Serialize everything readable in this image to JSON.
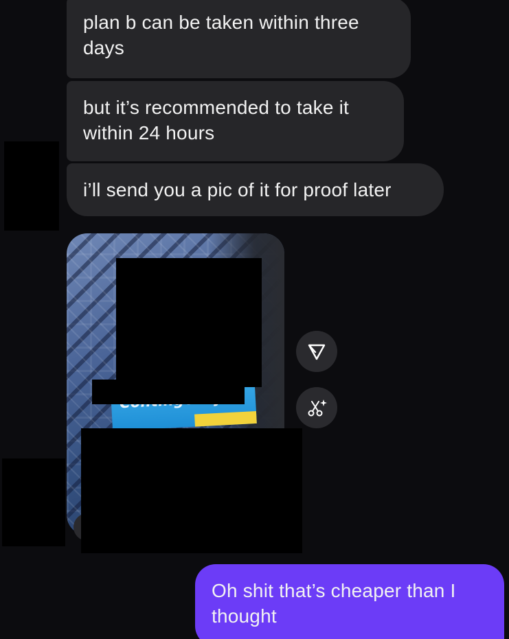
{
  "conversation": {
    "incoming_messages": [
      "plan b can be taken within three days",
      "but it’s recommended to take it within 24 hours",
      "i’ll send you a pic of it for proof later"
    ],
    "photo": {
      "visible_text": "Contingency",
      "action_icons": [
        "share-icon",
        "sparkle-edit-icon"
      ]
    },
    "outgoing_messages": [
      "Oh shit that’s cheaper than I thought"
    ]
  },
  "colors": {
    "background": "#0c0c0f",
    "incoming_bubble": "#262629",
    "outgoing_bubble": "#6c3cf7",
    "text": "#f2f2f2"
  }
}
